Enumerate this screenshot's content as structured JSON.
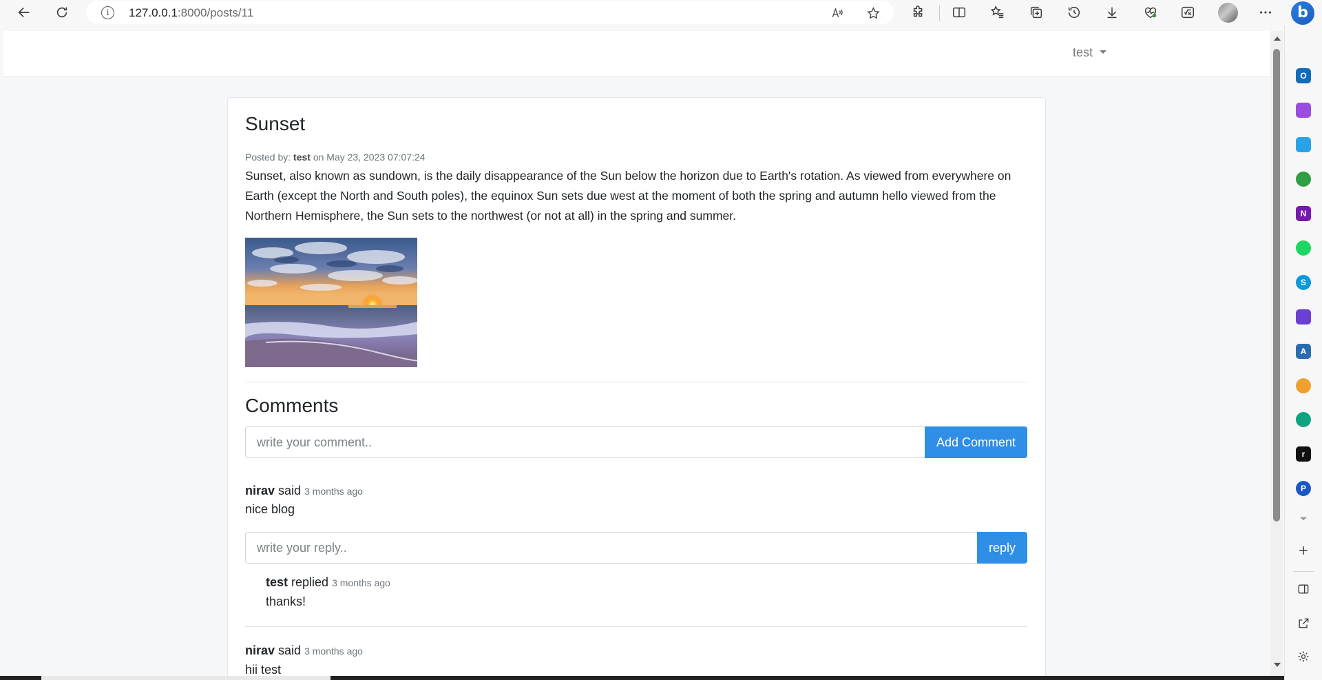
{
  "browser": {
    "url_host": "127.0.0.1",
    "url_path": ":8000/posts/11",
    "icons": [
      "back-icon",
      "refresh-icon",
      "info-icon",
      "read-aloud-icon",
      "favorite-star-icon",
      "extensions-icon",
      "split-screen-icon",
      "favorites-icon",
      "collections-icon",
      "history-icon",
      "downloads-icon",
      "browser-essentials-icon",
      "math-solver-icon",
      "profile-avatar",
      "more-icon",
      "bing-chat-icon"
    ]
  },
  "navbar": {
    "user_label": "test"
  },
  "post": {
    "title": "Sunset",
    "meta_prefix": "Posted by: ",
    "author": "test",
    "meta_suffix": " on May 23, 2023 07:07:24",
    "body": "Sunset, also known as sundown, is the daily disappearance of the Sun below the horizon due to Earth's rotation. As viewed from everywhere on Earth (except the North and South poles), the equinox Sun sets due west at the moment of both the spring and autumn hello viewed from the Northern Hemisphere, the Sun sets to the northwest (or not at all) in the spring and summer."
  },
  "comments": {
    "heading": "Comments",
    "input_placeholder": "write your comment..",
    "add_button": "Add Comment",
    "reply_placeholder": "write your reply..",
    "reply_button": "reply",
    "items": [
      {
        "author": "nirav",
        "verb": "said",
        "time": "3 months ago",
        "text": "nice blog",
        "replies": [
          {
            "author": "test",
            "verb": "replied",
            "time": "3 months ago",
            "text": "thanks!"
          }
        ]
      },
      {
        "author": "nirav",
        "verb": "said",
        "time": "3 months ago",
        "text": "hii test"
      }
    ]
  },
  "sidebar": {
    "apps": [
      {
        "name": "outlook",
        "letter": "O",
        "color": "#0f6cbd"
      },
      {
        "name": "designer",
        "letter": "",
        "color": "#9b4de0"
      },
      {
        "name": "telegram",
        "letter": "",
        "color": "#2aa3e6"
      },
      {
        "name": "tree",
        "letter": "",
        "color": "#2f9e44"
      },
      {
        "name": "onenote",
        "letter": "N",
        "color": "#7719aa"
      },
      {
        "name": "spotify",
        "letter": "",
        "color": "#1ed760"
      },
      {
        "name": "skype",
        "letter": "S",
        "color": "#0d98dd"
      },
      {
        "name": "clipchamp",
        "letter": "",
        "color": "#6b3fd4"
      },
      {
        "name": "translator",
        "letter": "A",
        "color": "#2b6cb0"
      },
      {
        "name": "rewards",
        "letter": "",
        "color": "#f0a030"
      },
      {
        "name": "chatgpt",
        "letter": "",
        "color": "#10a37f"
      },
      {
        "name": "r-app",
        "letter": "r",
        "color": "#111111"
      },
      {
        "name": "p-app",
        "letter": "P",
        "color": "#1a56c4"
      }
    ]
  }
}
